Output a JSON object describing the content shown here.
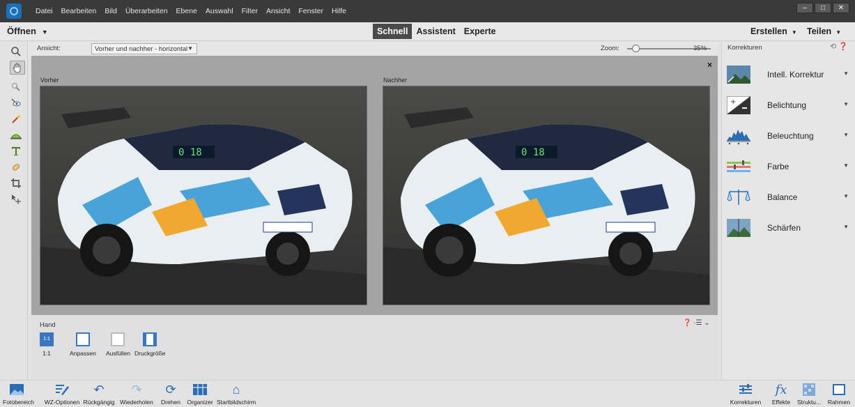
{
  "menu": [
    "Datei",
    "Bearbeiten",
    "Bild",
    "Überarbeiten",
    "Ebene",
    "Auswahl",
    "Filter",
    "Ansicht",
    "Fenster",
    "Hilfe"
  ],
  "window_controls": [
    "–",
    "□",
    "✕"
  ],
  "modebar": {
    "open_label": "Öffnen",
    "modes": [
      "Schnell",
      "Assistent",
      "Experte"
    ],
    "active_mode": "Schnell",
    "create_label": "Erstellen",
    "share_label": "Teilen"
  },
  "viewbar": {
    "view_label": "Ansicht:",
    "view_value": "Vorher und nachher - horizontal",
    "zoom_label": "Zoom:",
    "zoom_value": "35%",
    "zoom_fraction": 0.1
  },
  "canvas": {
    "before_label": "Vorher",
    "after_label": "Nachher",
    "close_glyph": "×"
  },
  "tool_options": {
    "tool_name": "Hand",
    "right_icons": "❓ ·☰ ⌄",
    "buttons": [
      {
        "box": "1:1",
        "label": "1:1"
      },
      {
        "box": "",
        "label": "Anpassen"
      },
      {
        "box": "",
        "label": "Ausfüllen"
      },
      {
        "box": "",
        "label": "Druckgröße"
      }
    ]
  },
  "panel": {
    "title": "Korrekturen",
    "header_icons": "⟲ ❓",
    "corrections": [
      {
        "label": "Intell. Korrektur",
        "icon": "smart-fix-icon"
      },
      {
        "label": "Belichtung",
        "icon": "exposure-icon"
      },
      {
        "label": "Beleuchtung",
        "icon": "lighting-icon"
      },
      {
        "label": "Farbe",
        "icon": "color-icon"
      },
      {
        "label": "Balance",
        "icon": "balance-icon"
      },
      {
        "label": "Schärfen",
        "icon": "sharpen-icon"
      }
    ]
  },
  "bottom_left": [
    {
      "label": "Fotobereich",
      "icon": "photo-bin-icon"
    },
    {
      "label": "WZ-Optionen",
      "icon": "tool-options-icon"
    },
    {
      "label": "Rückgängig",
      "icon": "undo-icon"
    },
    {
      "label": "Wiederholen",
      "icon": "redo-icon"
    },
    {
      "label": "Drehen",
      "icon": "rotate-icon"
    },
    {
      "label": "Organizer",
      "icon": "organizer-icon"
    },
    {
      "label": "Startbildschirm",
      "icon": "home-icon"
    }
  ],
  "bottom_right": [
    {
      "label": "Korrekturen",
      "icon": "adjustments-icon"
    },
    {
      "label": "Effekte",
      "icon": "effects-icon"
    },
    {
      "label": "Struktu...",
      "icon": "textures-icon"
    },
    {
      "label": "Rahmen",
      "icon": "frames-icon"
    }
  ],
  "colors": {
    "titlebar": "#3a3a3a",
    "accent_blue": "#2b6db3",
    "active_mode_bg": "#4a4a4a"
  }
}
